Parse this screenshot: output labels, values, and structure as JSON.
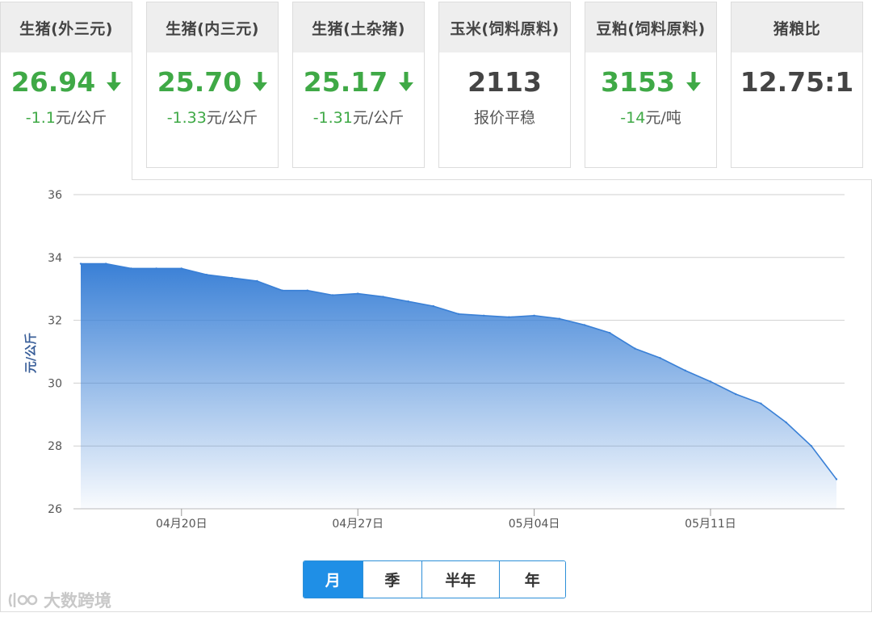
{
  "cards": [
    {
      "title": "生猪(外三元)",
      "value": "26.94",
      "trend": "down",
      "change_num": "-1.1",
      "change_unit": "元/公斤",
      "active": true
    },
    {
      "title": "生猪(内三元)",
      "value": "25.70",
      "trend": "down",
      "change_num": "-1.33",
      "change_unit": "元/公斤"
    },
    {
      "title": "生猪(土杂猪)",
      "value": "25.17",
      "trend": "down",
      "change_num": "-1.31",
      "change_unit": "元/公斤"
    },
    {
      "title": "玉米(饲料原料)",
      "value": "2113",
      "trend": "flat",
      "change_num": "",
      "change_unit": "报价平稳"
    },
    {
      "title": "豆粕(饲料原料)",
      "value": "3153",
      "trend": "down",
      "change_num": "-14",
      "change_unit": "元/吨"
    },
    {
      "title": "猪粮比",
      "value": "12.75:1",
      "trend": "none",
      "change_num": "",
      "change_unit": ""
    }
  ],
  "range_buttons": [
    "月",
    "季",
    "半年",
    "年"
  ],
  "range_selected": "月",
  "watermark": "大数跨境",
  "colors": {
    "down": "#3fa946",
    "accent": "#1f8fe6",
    "area_top": "#3a80d6",
    "line": "#3a80d6"
  },
  "chart_data": {
    "type": "area",
    "ylabel": "元/公斤",
    "xlabel": "",
    "ylim": [
      26,
      36
    ],
    "yticks": [
      26,
      28,
      30,
      32,
      34,
      36
    ],
    "xticks": [
      {
        "day": 5,
        "label": "04月20日"
      },
      {
        "day": 12,
        "label": "04月27日"
      },
      {
        "day": 19,
        "label": "05月04日"
      },
      {
        "day": 26,
        "label": "05月11日"
      }
    ],
    "x": [
      1,
      2,
      3,
      4,
      5,
      6,
      7,
      8,
      9,
      10,
      11,
      12,
      13,
      14,
      15,
      16,
      17,
      18,
      19,
      20,
      21,
      22,
      23,
      24,
      25,
      26,
      27,
      28,
      29,
      30,
      31
    ],
    "values": [
      33.8,
      33.8,
      33.65,
      33.65,
      33.65,
      33.45,
      33.35,
      33.25,
      32.95,
      32.95,
      32.8,
      32.85,
      32.75,
      32.6,
      32.45,
      32.2,
      32.15,
      32.1,
      32.15,
      32.05,
      31.85,
      31.6,
      31.1,
      30.8,
      30.4,
      30.05,
      29.65,
      29.35,
      28.75,
      28.0,
      26.94
    ]
  }
}
